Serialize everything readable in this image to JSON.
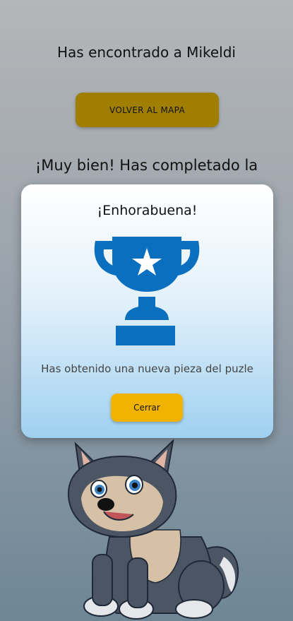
{
  "screen": {
    "found_title": "Has encontrado a Mikeldi",
    "back_button_label": "VOLVER AL MAPA",
    "completed_text": "¡Muy bien! Has completado la"
  },
  "modal": {
    "title": "¡Enhorabuena!",
    "icon": "trophy-icon",
    "message": "Has obtenido una nueva pieza del puzle",
    "close_button_label": "Cerrar"
  },
  "illustration": {
    "icon": "wolf-pup-illustration"
  },
  "colors": {
    "back_button": "#9f7e00",
    "close_button": "#f0b400",
    "trophy": "#0a6fbe",
    "modal_gradient_top": "#ffffff",
    "modal_gradient_bottom": "#9fd0f0"
  }
}
